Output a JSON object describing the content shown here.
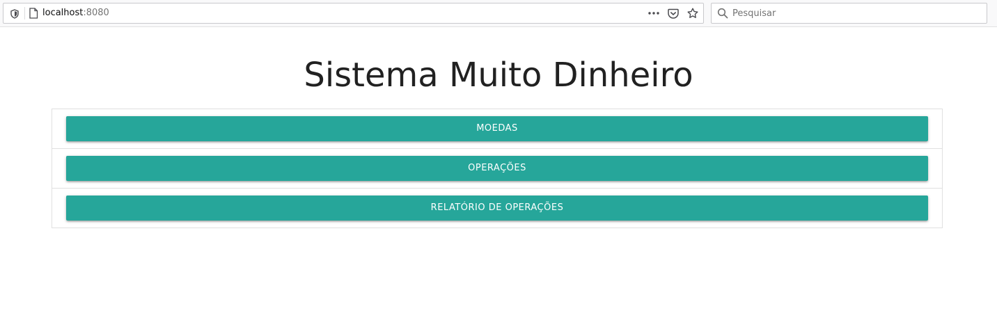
{
  "browser": {
    "url_host": "localhost",
    "url_port": ":8080",
    "search_placeholder": "Pesquisar",
    "icons": {
      "shield": "shield-icon",
      "page": "page-icon",
      "more": "more-actions-icon",
      "pocket": "pocket-icon",
      "bookmark": "bookmark-star-icon",
      "search": "search-icon"
    }
  },
  "page": {
    "title": "Sistema Muito Dinheiro",
    "menu": [
      {
        "label": "MOEDAS"
      },
      {
        "label": "OPERAÇÕES"
      },
      {
        "label": "RELATÓRIO DE OPERAÇÕES"
      }
    ]
  },
  "colors": {
    "button": "#26a69a",
    "button_text": "#ffffff",
    "title": "#212121",
    "panel_border": "#e0e0e0"
  }
}
